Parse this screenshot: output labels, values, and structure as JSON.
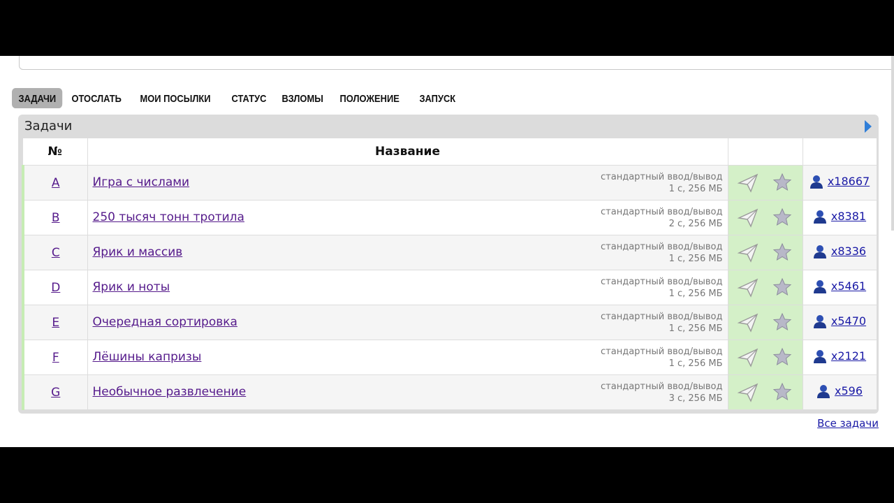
{
  "menu": [
    "ЗАДАЧИ",
    "ОТОСЛАТЬ",
    "МОИ ПОСЫЛКИ",
    "СТАТУС",
    "ВЗЛОМЫ",
    "ПОЛОЖЕНИЕ",
    "ЗАПУСК"
  ],
  "panel": {
    "title": "Задачи"
  },
  "table": {
    "col_id": "№",
    "col_name": "Название"
  },
  "problems": [
    {
      "id": "A",
      "name": "Игра с числами",
      "io": "стандартный ввод/вывод",
      "limits": "1 с, 256 МБ",
      "solved": "x18667"
    },
    {
      "id": "B",
      "name": "250 тысяч тонн тротила",
      "io": "стандартный ввод/вывод",
      "limits": "2 с, 256 МБ",
      "solved": "x8381"
    },
    {
      "id": "C",
      "name": "Ярик и массив",
      "io": "стандартный ввод/вывод",
      "limits": "1 с, 256 МБ",
      "solved": "x8336"
    },
    {
      "id": "D",
      "name": "Ярик и ноты",
      "io": "стандартный ввод/вывод",
      "limits": "1 с, 256 МБ",
      "solved": "x5461"
    },
    {
      "id": "E",
      "name": "Очередная сортировка",
      "io": "стандартный ввод/вывод",
      "limits": "1 с, 256 МБ",
      "solved": "x5470"
    },
    {
      "id": "F",
      "name": "Лёшины капризы",
      "io": "стандартный ввод/вывод",
      "limits": "1 с, 256 МБ",
      "solved": "x2121"
    },
    {
      "id": "G",
      "name": "Необычное развлечение",
      "io": "стандартный ввод/вывод",
      "limits": "3 с, 256 МБ",
      "solved": "x596"
    }
  ],
  "footer": {
    "all_problems": "Все задачи"
  },
  "colors": {
    "accent": "#3b5998",
    "accepted": "#d4f0c8",
    "link": "#551a8b"
  }
}
